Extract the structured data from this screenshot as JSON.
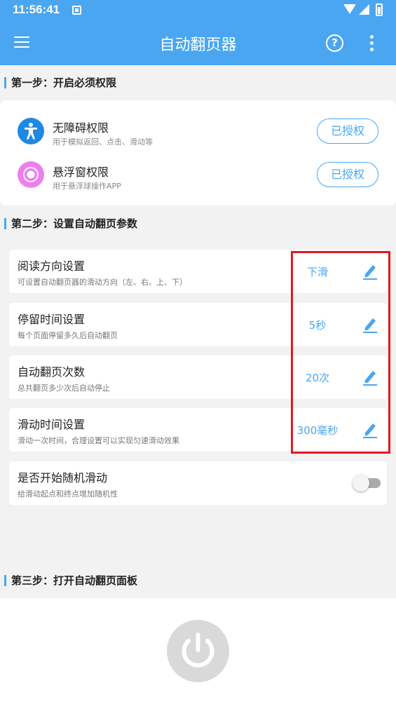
{
  "status_bar": {
    "time": "11:56:41"
  },
  "app_bar": {
    "title": "自动翻页器",
    "help_icon": "?"
  },
  "step1": {
    "title": "第一步：开启必须权限",
    "permissions": [
      {
        "name": "无障碍权限",
        "desc": "用于模拟返回、点击、滑动等",
        "button": "已授权",
        "icon": "accessibility-icon",
        "icon_color": "#1e88e5"
      },
      {
        "name": "悬浮窗权限",
        "desc": "用于悬浮球操作APP",
        "button": "已授权",
        "icon": "floating-ball-icon",
        "icon_color": "#ee7ef0"
      }
    ]
  },
  "step2": {
    "title": "第二步：设置自动翻页参数",
    "params": [
      {
        "name": "阅读方向设置",
        "desc": "可设置自动翻页器的滑动方向（左、右、上、下）",
        "value": "下滑"
      },
      {
        "name": "停留时间设置",
        "desc": "每个页面停留多久后自动翻页",
        "value": "5秒"
      },
      {
        "name": "自动翻页次数",
        "desc": "总共翻页多少次后自动停止",
        "value": "20次"
      },
      {
        "name": "滑动时间设置",
        "desc": "滑动一次时间，合理设置可以实现匀速滑动效果",
        "value": "300毫秒"
      }
    ],
    "random": {
      "name": "是否开始随机滑动",
      "desc": "给滑动起点和终点增加随机性",
      "enabled": false
    }
  },
  "step3": {
    "title": "第三步：打开自动翻页面板"
  },
  "colors": {
    "primary": "#4aa6f0",
    "highlight": "#e6161f",
    "power_button": "#d9d9d9"
  }
}
